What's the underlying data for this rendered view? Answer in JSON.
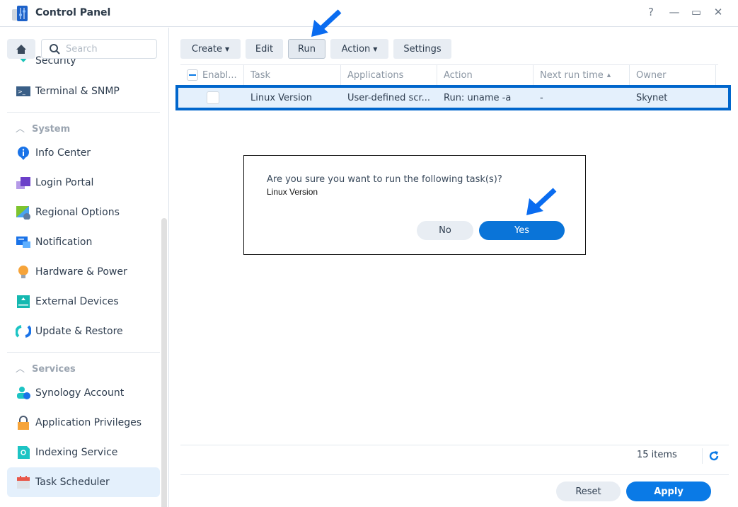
{
  "window": {
    "title": "Control Panel",
    "help": "?",
    "minimize": "—",
    "maximize": "▭",
    "close": "✕"
  },
  "search": {
    "placeholder": "Search"
  },
  "sidebar": {
    "partial_item": "Security",
    "terminal": "Terminal & SNMP",
    "sections": [
      {
        "title": "System",
        "items": [
          "Info Center",
          "Login Portal",
          "Regional Options",
          "Notification",
          "Hardware & Power",
          "External Devices",
          "Update & Restore"
        ]
      },
      {
        "title": "Services",
        "items": [
          "Synology Account",
          "Application Privileges",
          "Indexing Service",
          "Task Scheduler"
        ]
      }
    ],
    "selected": "Task Scheduler"
  },
  "toolbar": {
    "create": "Create",
    "edit": "Edit",
    "run": "Run",
    "action": "Action",
    "settings": "Settings"
  },
  "table": {
    "columns": [
      "Enabl...",
      "Task",
      "Applications",
      "Action",
      "Next run time",
      "Owner"
    ],
    "sort_indicator": "▲",
    "rows": [
      {
        "enabled": false,
        "task": "Linux Version",
        "applications": "User-defined scr...",
        "action": "Run: uname -a",
        "next_run": "-",
        "owner": "Skynet"
      }
    ]
  },
  "footer": {
    "count": "15 items",
    "reset": "Reset",
    "apply": "Apply"
  },
  "dialog": {
    "message": "Are you sure you want to run the following task(s)?",
    "task": "Linux Version",
    "no": "No",
    "yes": "Yes"
  },
  "colors": {
    "accent": "#0a7ae6",
    "highlight_outline": "#0066cc",
    "annotation_arrow": "#0a6cf0",
    "selected_bg": "#e4f0fc"
  }
}
